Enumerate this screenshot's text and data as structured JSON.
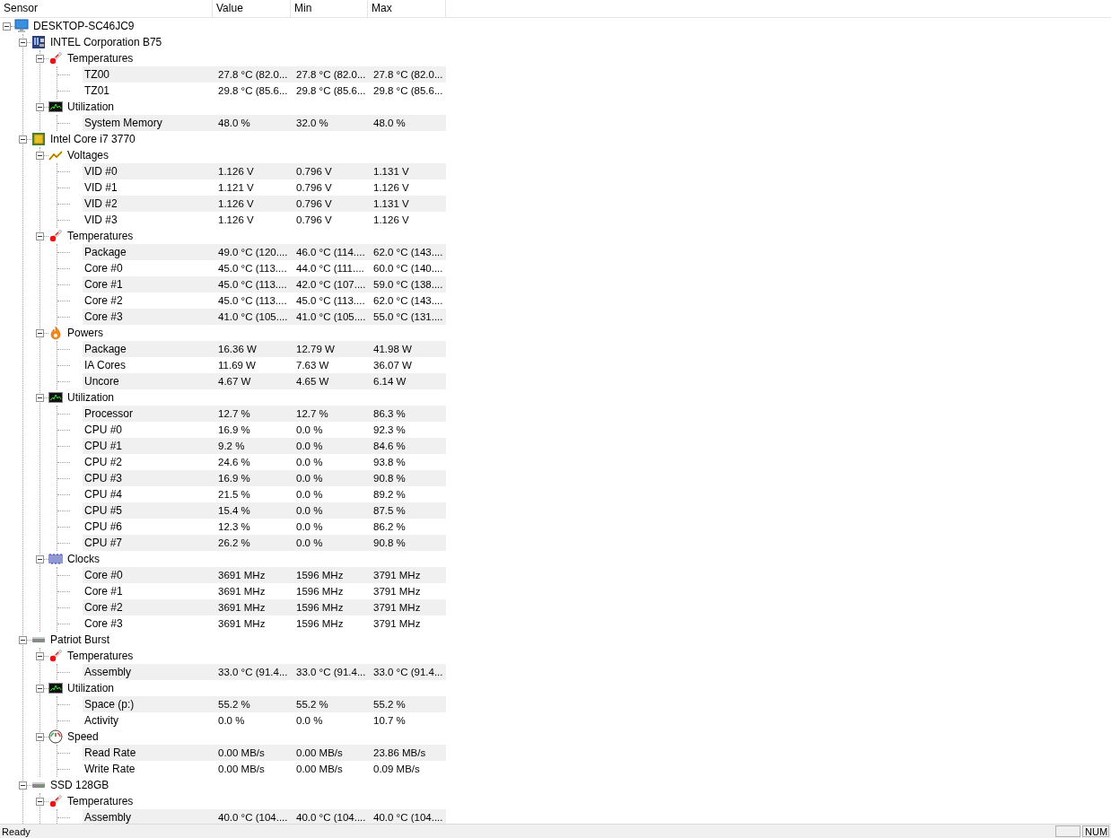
{
  "columns": [
    "Sensor",
    "Value",
    "Min",
    "Max"
  ],
  "tree": {
    "label": "DESKTOP-SC46JC9",
    "kind": "computer",
    "expanded": true,
    "children": [
      {
        "label": "INTEL Corporation B75",
        "kind": "motherboard",
        "expanded": true,
        "groups": [
          {
            "label": "Temperatures",
            "kind": "temperature",
            "expanded": true,
            "sensors": [
              {
                "label": "TZ00",
                "value": "27.8 °C  (82.0...",
                "min": "27.8 °C  (82.0...",
                "max": "27.8 °C  (82.0..."
              },
              {
                "label": "TZ01",
                "value": "29.8 °C  (85.6...",
                "min": "29.8 °C  (85.6...",
                "max": "29.8 °C  (85.6..."
              }
            ]
          },
          {
            "label": "Utilization",
            "kind": "utilization",
            "expanded": true,
            "sensors": [
              {
                "label": "System Memory",
                "value": "48.0 %",
                "min": "32.0 %",
                "max": "48.0 %"
              }
            ]
          }
        ]
      },
      {
        "label": "Intel Core i7 3770",
        "kind": "cpu",
        "expanded": true,
        "groups": [
          {
            "label": "Voltages",
            "kind": "voltage",
            "expanded": true,
            "sensors": [
              {
                "label": "VID #0",
                "value": "1.126 V",
                "min": "0.796 V",
                "max": "1.131 V"
              },
              {
                "label": "VID #1",
                "value": "1.121 V",
                "min": "0.796 V",
                "max": "1.126 V"
              },
              {
                "label": "VID #2",
                "value": "1.126 V",
                "min": "0.796 V",
                "max": "1.131 V"
              },
              {
                "label": "VID #3",
                "value": "1.126 V",
                "min": "0.796 V",
                "max": "1.126 V"
              }
            ]
          },
          {
            "label": "Temperatures",
            "kind": "temperature",
            "expanded": true,
            "sensors": [
              {
                "label": "Package",
                "value": "49.0 °C  (120....",
                "min": "46.0 °C  (114....",
                "max": "62.0 °C  (143...."
              },
              {
                "label": "Core #0",
                "value": "45.0 °C  (113....",
                "min": "44.0 °C  (111....",
                "max": "60.0 °C  (140...."
              },
              {
                "label": "Core #1",
                "value": "45.0 °C  (113....",
                "min": "42.0 °C  (107....",
                "max": "59.0 °C  (138...."
              },
              {
                "label": "Core #2",
                "value": "45.0 °C  (113....",
                "min": "45.0 °C  (113....",
                "max": "62.0 °C  (143...."
              },
              {
                "label": "Core #3",
                "value": "41.0 °C  (105....",
                "min": "41.0 °C  (105....",
                "max": "55.0 °C  (131...."
              }
            ]
          },
          {
            "label": "Powers",
            "kind": "power",
            "expanded": true,
            "sensors": [
              {
                "label": "Package",
                "value": "16.36 W",
                "min": "12.79 W",
                "max": "41.98 W"
              },
              {
                "label": "IA Cores",
                "value": "11.69 W",
                "min": "7.63 W",
                "max": "36.07 W"
              },
              {
                "label": "Uncore",
                "value": "4.67 W",
                "min": "4.65 W",
                "max": "6.14 W"
              }
            ]
          },
          {
            "label": "Utilization",
            "kind": "utilization",
            "expanded": true,
            "sensors": [
              {
                "label": "Processor",
                "value": "12.7 %",
                "min": "12.7 %",
                "max": "86.3 %"
              },
              {
                "label": "CPU #0",
                "value": "16.9 %",
                "min": "0.0 %",
                "max": "92.3 %"
              },
              {
                "label": "CPU #1",
                "value": "9.2 %",
                "min": "0.0 %",
                "max": "84.6 %"
              },
              {
                "label": "CPU #2",
                "value": "24.6 %",
                "min": "0.0 %",
                "max": "93.8 %"
              },
              {
                "label": "CPU #3",
                "value": "16.9 %",
                "min": "0.0 %",
                "max": "90.8 %"
              },
              {
                "label": "CPU #4",
                "value": "21.5 %",
                "min": "0.0 %",
                "max": "89.2 %"
              },
              {
                "label": "CPU #5",
                "value": "15.4 %",
                "min": "0.0 %",
                "max": "87.5 %"
              },
              {
                "label": "CPU #6",
                "value": "12.3 %",
                "min": "0.0 %",
                "max": "86.2 %"
              },
              {
                "label": "CPU #7",
                "value": "26.2 %",
                "min": "0.0 %",
                "max": "90.8 %"
              }
            ]
          },
          {
            "label": "Clocks",
            "kind": "clock",
            "expanded": true,
            "sensors": [
              {
                "label": "Core #0",
                "value": "3691 MHz",
                "min": "1596 MHz",
                "max": "3791 MHz"
              },
              {
                "label": "Core #1",
                "value": "3691 MHz",
                "min": "1596 MHz",
                "max": "3791 MHz"
              },
              {
                "label": "Core #2",
                "value": "3691 MHz",
                "min": "1596 MHz",
                "max": "3791 MHz"
              },
              {
                "label": "Core #3",
                "value": "3691 MHz",
                "min": "1596 MHz",
                "max": "3791 MHz"
              }
            ]
          }
        ]
      },
      {
        "label": "Patriot Burst",
        "kind": "drive",
        "expanded": true,
        "groups": [
          {
            "label": "Temperatures",
            "kind": "temperature",
            "expanded": true,
            "sensors": [
              {
                "label": "Assembly",
                "value": "33.0 °C  (91.4...",
                "min": "33.0 °C  (91.4...",
                "max": "33.0 °C  (91.4..."
              }
            ]
          },
          {
            "label": "Utilization",
            "kind": "utilization",
            "expanded": true,
            "sensors": [
              {
                "label": "Space (p:)",
                "value": "55.2 %",
                "min": "55.2 %",
                "max": "55.2 %"
              },
              {
                "label": "Activity",
                "value": "0.0 %",
                "min": "0.0 %",
                "max": "10.7 %"
              }
            ]
          },
          {
            "label": "Speed",
            "kind": "speed",
            "expanded": true,
            "sensors": [
              {
                "label": "Read Rate",
                "value": "0.00 MB/s",
                "min": "0.00 MB/s",
                "max": "23.86 MB/s"
              },
              {
                "label": "Write Rate",
                "value": "0.00 MB/s",
                "min": "0.00 MB/s",
                "max": "0.09 MB/s"
              }
            ]
          }
        ]
      },
      {
        "label": "SSD 128GB",
        "kind": "drive",
        "expanded": true,
        "groups": [
          {
            "label": "Temperatures",
            "kind": "temperature",
            "expanded": true,
            "sensors": [
              {
                "label": "Assembly",
                "value": "40.0 °C  (104....",
                "min": "40.0 °C  (104....",
                "max": "40.0 °C  (104...."
              }
            ]
          }
        ]
      }
    ]
  },
  "status_bar": {
    "text": "Ready",
    "num_lock": "NUM"
  }
}
